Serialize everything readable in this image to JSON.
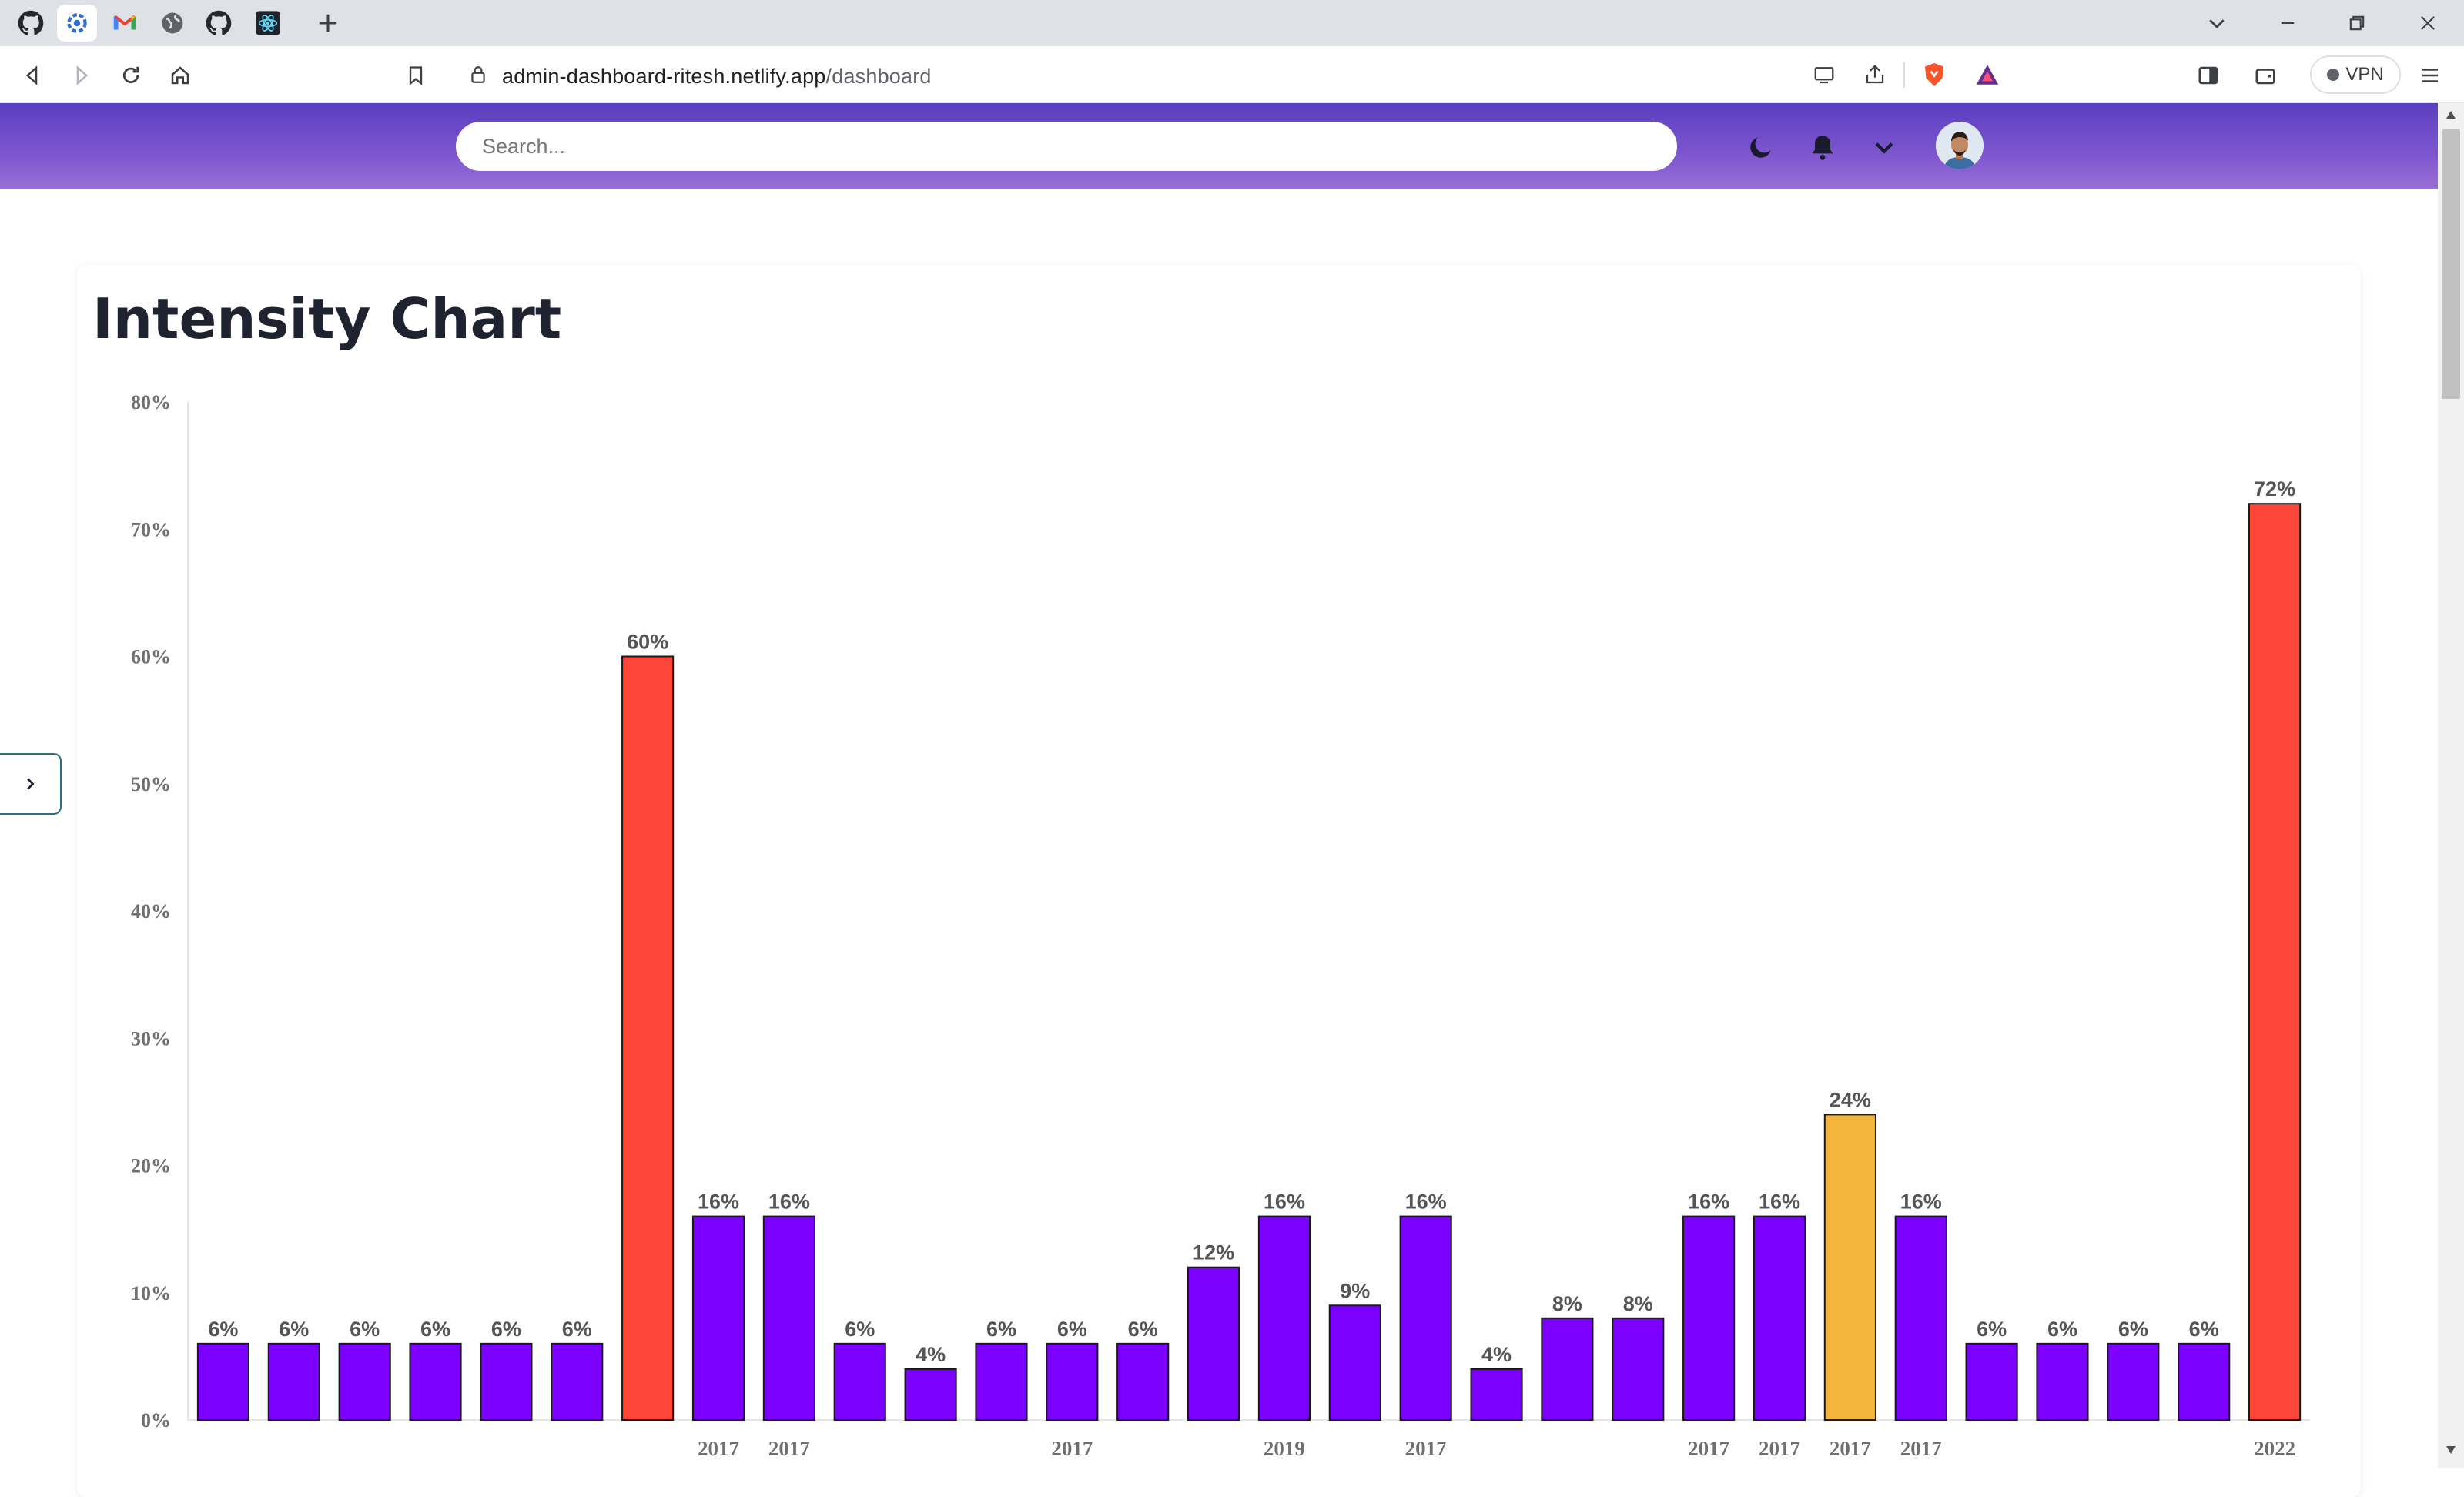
{
  "browser": {
    "tabs": [
      {
        "icon": "github-icon",
        "active": false
      },
      {
        "icon": "dashboard-gear-icon",
        "active": true
      },
      {
        "icon": "gmail-icon",
        "active": false
      },
      {
        "icon": "globe-icon",
        "active": false
      },
      {
        "icon": "github-icon",
        "active": false
      },
      {
        "icon": "react-icon",
        "active": false
      }
    ],
    "url_host": "admin-dashboard-ritesh.netlify.app",
    "url_path": "/dashboard",
    "vpn_label": "VPN"
  },
  "header": {
    "search_placeholder": "Search..."
  },
  "card": {
    "title": "Intensity Chart"
  },
  "colors": {
    "accent": "#7b00ff",
    "high": "#ff443a",
    "medium": "#f3b53b",
    "header_top": "#5a3fc0",
    "header_bottom": "#9a6fd6"
  },
  "chart_data": {
    "type": "bar",
    "title": "Intensity Chart",
    "xlabel": "",
    "ylabel": "",
    "ylim": [
      0,
      80
    ],
    "yticks": [
      "0%",
      "10%",
      "20%",
      "30%",
      "40%",
      "50%",
      "60%",
      "70%",
      "80%"
    ],
    "grid": false,
    "legend": "none",
    "categories": [
      "",
      "",
      "",
      "",
      "",
      "",
      "",
      "2017",
      "2017",
      "",
      "",
      "",
      "2017",
      "",
      "",
      "2019",
      "",
      "2017",
      "",
      "",
      "",
      "2017",
      "2017",
      "2017",
      "2017",
      "",
      "",
      "",
      "",
      "2022"
    ],
    "values": [
      6,
      6,
      6,
      6,
      6,
      6,
      60,
      16,
      16,
      6,
      4,
      6,
      6,
      6,
      12,
      16,
      9,
      16,
      4,
      8,
      8,
      16,
      16,
      24,
      16,
      6,
      6,
      6,
      6,
      72
    ],
    "value_labels": [
      "6%",
      "6%",
      "6%",
      "6%",
      "6%",
      "6%",
      "60%",
      "16%",
      "16%",
      "6%",
      "4%",
      "6%",
      "6%",
      "6%",
      "12%",
      "16%",
      "9%",
      "16%",
      "4%",
      "8%",
      "8%",
      "16%",
      "16%",
      "24%",
      "16%",
      "6%",
      "6%",
      "6%",
      "6%",
      "72%"
    ],
    "color_rule": {
      "high_threshold": 50,
      "medium_threshold": 20
    }
  }
}
